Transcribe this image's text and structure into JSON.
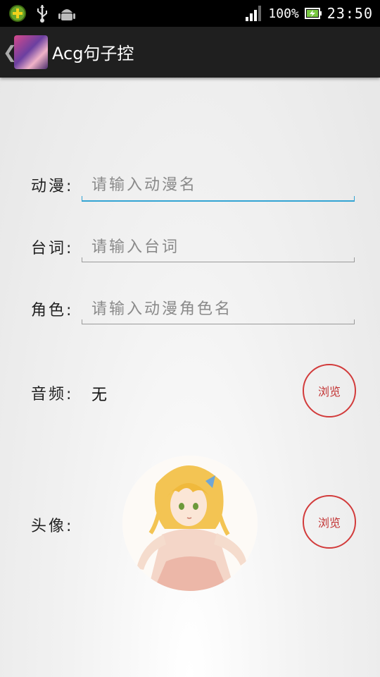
{
  "status_bar": {
    "battery": "100%",
    "time": "23:50",
    "icons": [
      "app-notification-icon",
      "usb-icon",
      "android-debug-icon",
      "signal-icon",
      "battery-charging-icon"
    ]
  },
  "action_bar": {
    "back_icon": "chevron-left-icon",
    "title": "Acg句子控"
  },
  "form": {
    "anime": {
      "label": "动漫:",
      "placeholder": "请输入动漫名"
    },
    "quote": {
      "label": "台词:",
      "placeholder": "请输入台词"
    },
    "character": {
      "label": "角色:",
      "placeholder": "请输入动漫角色名"
    },
    "audio": {
      "label": "音频:",
      "value": "无",
      "button": "浏览"
    },
    "avatar": {
      "label": "头像:",
      "button": "浏览"
    }
  },
  "colors": {
    "accent_blue": "#33a4d3",
    "browse_red": "#d23b3b",
    "action_bar": "#1f1f1f"
  }
}
